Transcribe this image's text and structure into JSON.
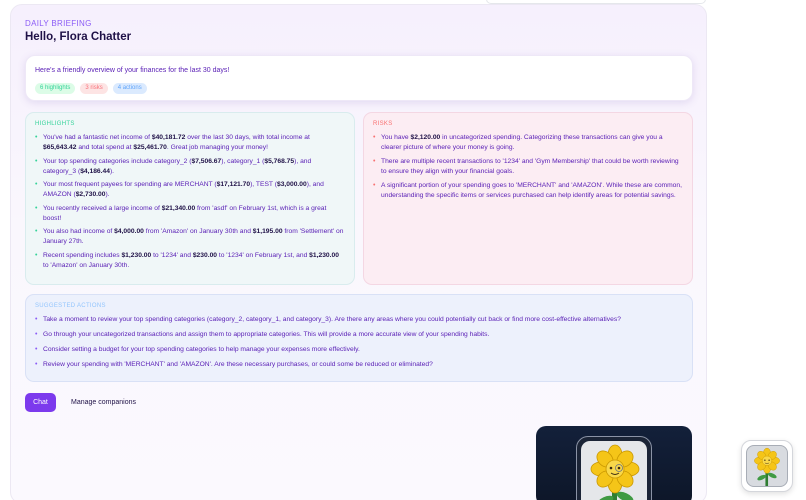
{
  "briefing": {
    "eyebrow": "DAILY BRIEFING",
    "greeting": "Hello, Flora Chatter",
    "overview": "Here's a friendly overview of your finances for the last 30 days!",
    "badges": {
      "highlights": "6 highlights",
      "risks": "3 risks",
      "actions": "4 actions"
    }
  },
  "highlights": {
    "title": "HIGHLIGHTS",
    "items": [
      [
        {
          "t": "You've had a fantastic net income of "
        },
        {
          "t": "$40,181.72",
          "b": true
        },
        {
          "t": " over the last 30 days, with total income at "
        },
        {
          "t": "$65,643.42",
          "b": true
        },
        {
          "t": " and total spend at "
        },
        {
          "t": "$25,461.70",
          "b": true
        },
        {
          "t": ". Great job managing your money!"
        }
      ],
      [
        {
          "t": "Your top spending categories include category_2 ("
        },
        {
          "t": "$7,506.67",
          "b": true
        },
        {
          "t": "), category_1 ("
        },
        {
          "t": "$5,768.75",
          "b": true
        },
        {
          "t": "), and category_3 ("
        },
        {
          "t": "$4,186.44",
          "b": true
        },
        {
          "t": ")."
        }
      ],
      [
        {
          "t": "Your most frequent payees for spending are MERCHANT ("
        },
        {
          "t": "$17,121.70",
          "b": true
        },
        {
          "t": "), TEST ("
        },
        {
          "t": "$3,000.00",
          "b": true
        },
        {
          "t": "), and AMAZON ("
        },
        {
          "t": "$2,730.00",
          "b": true
        },
        {
          "t": ")."
        }
      ],
      [
        {
          "t": "You recently received a large income of "
        },
        {
          "t": "$21,340.00",
          "b": true
        },
        {
          "t": " from 'asdf' on February 1st, which is a great boost!"
        }
      ],
      [
        {
          "t": "You also had income of "
        },
        {
          "t": "$4,000.00",
          "b": true
        },
        {
          "t": " from 'Amazon' on January 30th and "
        },
        {
          "t": "$1,195.00",
          "b": true
        },
        {
          "t": " from 'Settlement' on January 27th."
        }
      ],
      [
        {
          "t": "Recent spending includes "
        },
        {
          "t": "$1,230.00",
          "b": true
        },
        {
          "t": " to '1234' and "
        },
        {
          "t": "$230.00",
          "b": true
        },
        {
          "t": " to '1234' on February 1st, and "
        },
        {
          "t": "$1,230.00",
          "b": true
        },
        {
          "t": " to 'Amazon' on January 30th."
        }
      ]
    ]
  },
  "risks": {
    "title": "RISKS",
    "items": [
      [
        {
          "t": "You have "
        },
        {
          "t": "$2,120.00",
          "b": true
        },
        {
          "t": " in uncategorized spending. Categorizing these transactions can give you a clearer picture of where your money is going."
        }
      ],
      [
        {
          "t": "There are multiple recent transactions to '1234' and 'Gym Membership' that could be worth reviewing to ensure they align with your financial goals."
        }
      ],
      [
        {
          "t": "A significant portion of your spending goes to 'MERCHANT' and 'AMAZON'. While these are common, understanding the specific items or services purchased can help identify areas for potential savings."
        }
      ]
    ]
  },
  "actions": {
    "title": "SUGGESTED ACTIONS",
    "items": [
      [
        {
          "t": "Take a moment to review your top spending categories (category_2, category_1, and category_3). Are there any areas where you could potentially cut back or find more cost-effective alternatives?"
        }
      ],
      [
        {
          "t": "Go through your uncategorized transactions and assign them to appropriate categories. This will provide a more accurate view of your spending habits."
        }
      ],
      [
        {
          "t": "Consider setting a budget for your top spending categories to help manage your expenses more effectively."
        }
      ],
      [
        {
          "t": "Review your spending with 'MERCHANT' and 'AMAZON'. Are these necessary purchases, or could some be reduced or eliminated?"
        }
      ]
    ]
  },
  "footer": {
    "chat_label": "Chat",
    "manage_label": "Manage companions"
  },
  "companion": {
    "icon": "sunflower-companion-icon"
  },
  "colors": {
    "accent": "#7c3aed",
    "highlights": "#34d399",
    "risks": "#f87171",
    "actions": "#93c5fd"
  }
}
